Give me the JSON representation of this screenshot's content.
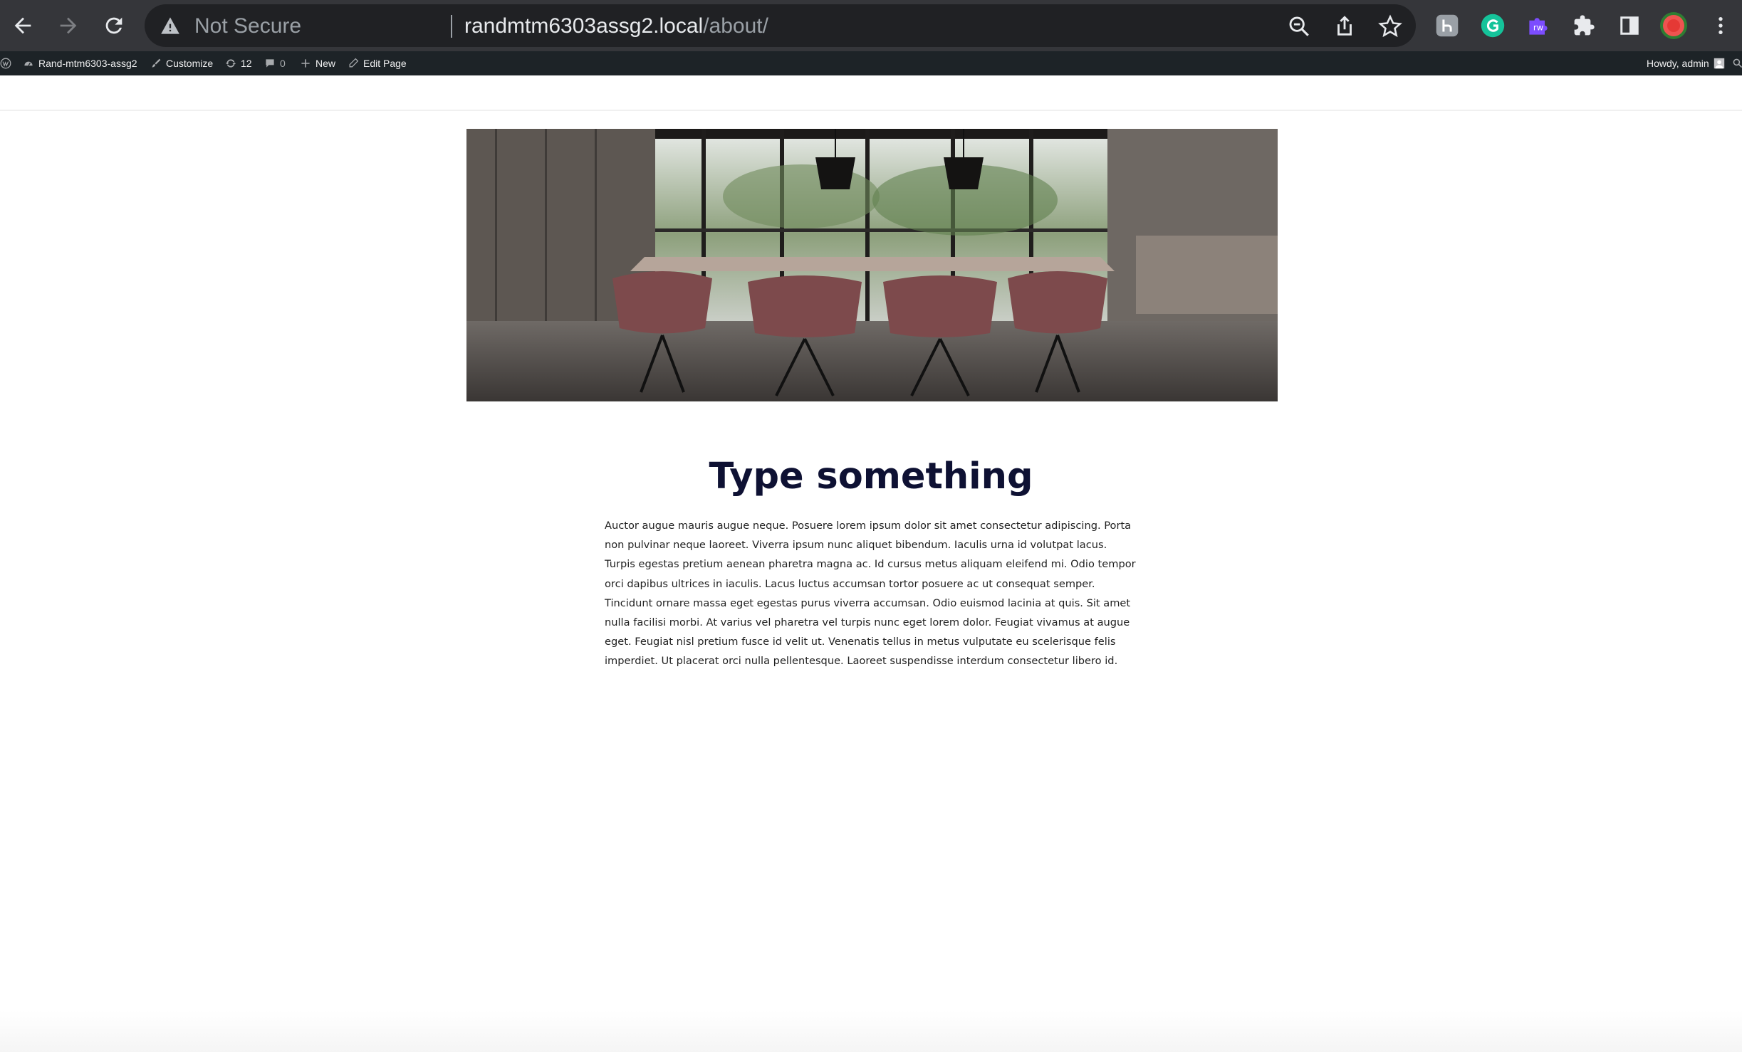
{
  "browser": {
    "not_secure_label": "Not Secure",
    "url_host": "randmtm6303assg2.local",
    "url_path": "/about/",
    "icons": [
      "back-icon",
      "forward-icon",
      "reload-icon",
      "warning-icon",
      "zoom-icon",
      "share-icon",
      "star-icon",
      "puzzle-icon",
      "side-panel-icon",
      "menu-icon"
    ],
    "extensions": [
      "h-extension",
      "grammarly-extension",
      "rw-extension",
      "profile-avatar"
    ],
    "rw_label": "rw"
  },
  "admin_bar": {
    "site_name": "Rand-mtm6303-assg2",
    "customize": "Customize",
    "updates_count": "12",
    "comments_count": "0",
    "new_label": "New",
    "edit_page": "Edit Page",
    "howdy": "Howdy, admin"
  },
  "page": {
    "hero_alt": "meeting room with table and pink chairs",
    "title": "Type something",
    "body": "Auctor augue mauris augue neque. Posuere lorem ipsum dolor sit amet consectetur adipiscing. Porta non pulvinar neque laoreet. Viverra ipsum nunc aliquet bibendum. Iaculis urna id volutpat lacus. Turpis egestas pretium aenean pharetra magna ac. Id cursus metus aliquam eleifend mi. Odio tempor orci dapibus ultrices in iaculis. Lacus luctus accumsan tortor posuere ac ut consequat semper. Tincidunt ornare massa eget egestas purus viverra accumsan. Odio euismod lacinia at quis. Sit amet nulla facilisi morbi. At varius vel pharetra vel turpis nunc eget lorem dolor. Feugiat vivamus at augue eget. Feugiat nisl pretium fusce id velit ut. Venenatis tellus in metus vulputate eu scelerisque felis imperdiet. Ut placerat orci nulla pellentesque. Laoreet suspendisse interdum consectetur libero id."
  },
  "colors": {
    "chrome_bg": "#35363a",
    "omnibox_bg": "#202124",
    "admin_bar_bg": "#1d2327",
    "title_color": "#0e1133"
  }
}
